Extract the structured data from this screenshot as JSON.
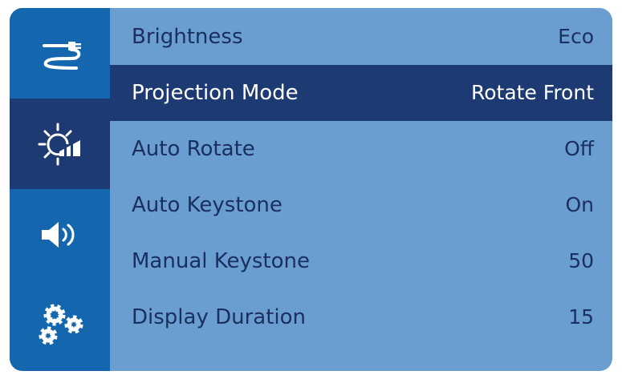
{
  "sidebar": {
    "items": [
      {
        "icon": "cable-icon",
        "active": false
      },
      {
        "icon": "brightness-projection-icon",
        "active": true
      },
      {
        "icon": "speaker-icon",
        "active": false
      },
      {
        "icon": "gears-icon",
        "active": false
      }
    ]
  },
  "menu": {
    "selected_index": 1,
    "items": [
      {
        "label": "Brightness",
        "value": "Eco"
      },
      {
        "label": "Projection Mode",
        "value": "Rotate Front"
      },
      {
        "label": "Auto Rotate",
        "value": "Off"
      },
      {
        "label": "Auto Keystone",
        "value": "On"
      },
      {
        "label": "Manual Keystone",
        "value": "50"
      },
      {
        "label": "Display Duration",
        "value": "15"
      }
    ]
  },
  "colors": {
    "sidebar_bg": "#1467ae",
    "active_bg": "#1d3a73",
    "content_bg": "#6a9ed1",
    "text": "#1a2f5e",
    "selected_text": "#ffffff"
  }
}
